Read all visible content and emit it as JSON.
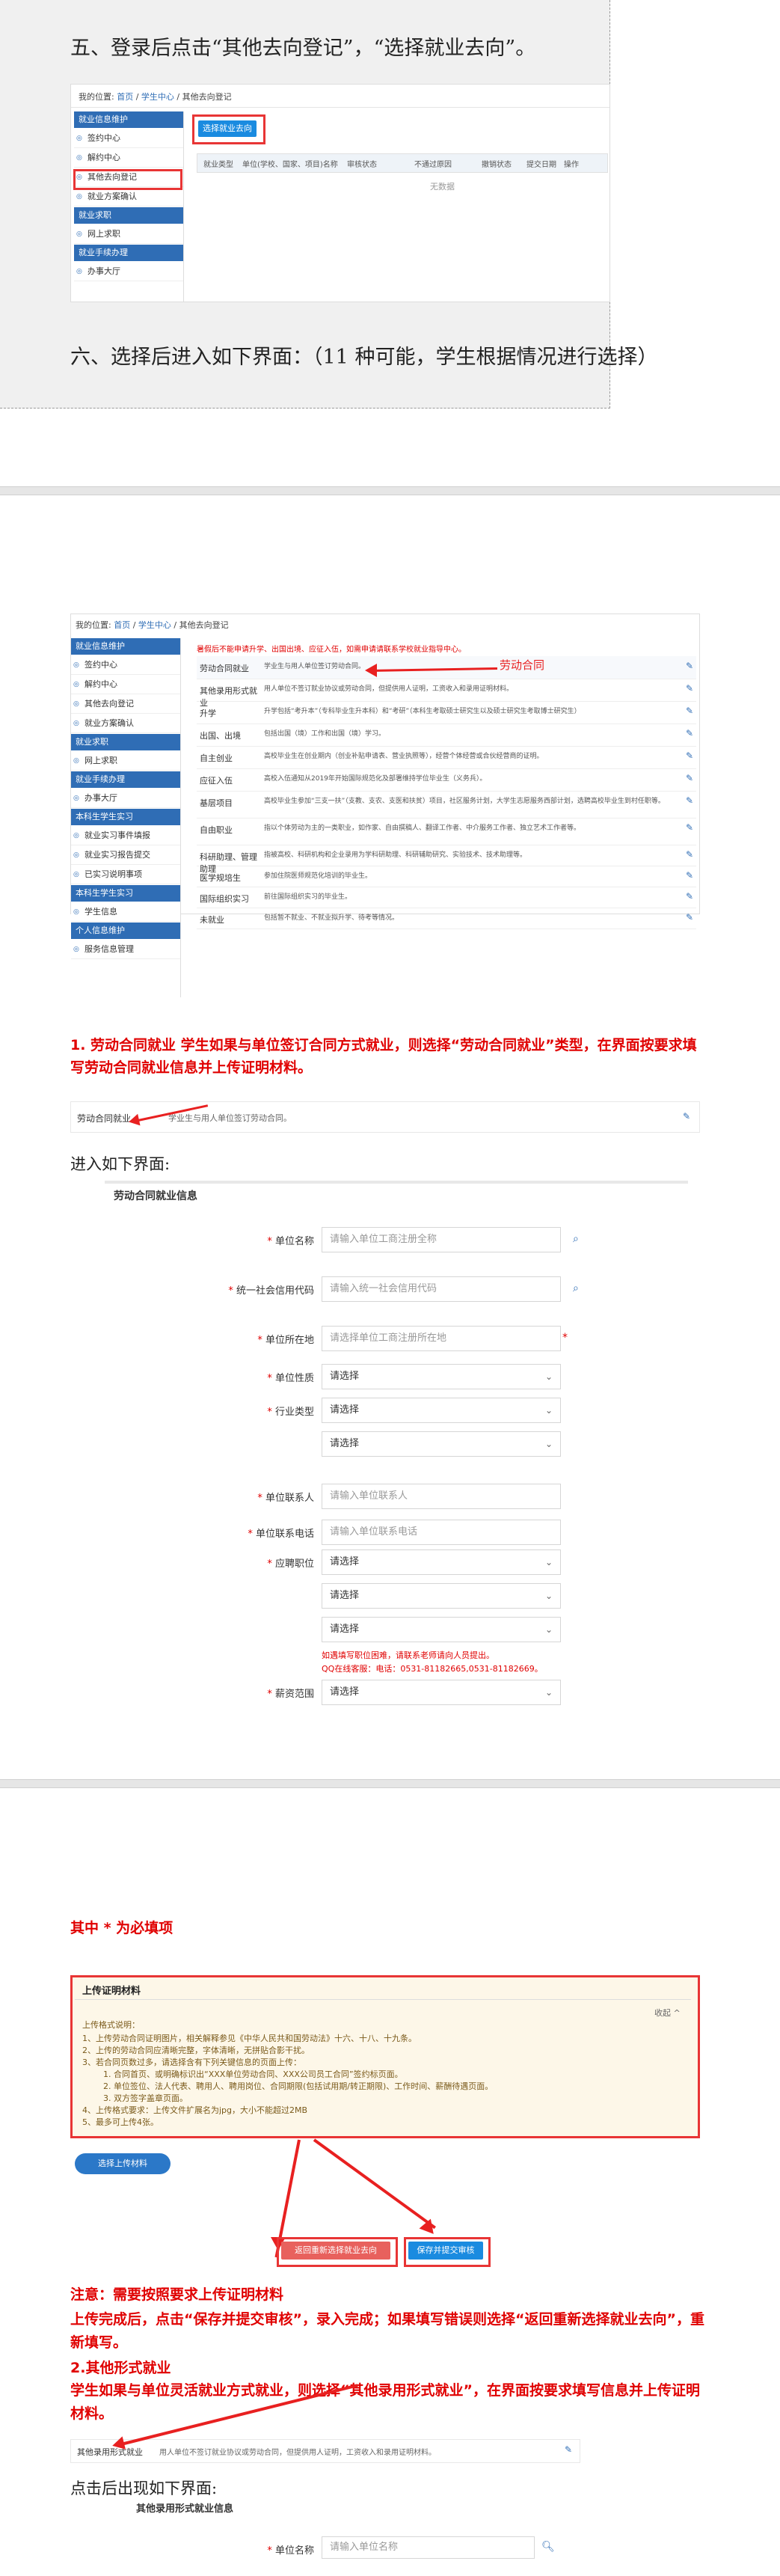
{
  "section5": {
    "heading": "五、登录后点击“其他去向登记”，“选择就业去向”。",
    "breadcrumb_prefix": "我的位置:",
    "breadcrumb_home": "首页",
    "breadcrumb_center": "学生中心",
    "breadcrumb_current": "其他去向登记",
    "sidebar": [
      {
        "type": "head",
        "label": "就业信息维护"
      },
      {
        "type": "item",
        "label": "签约中心"
      },
      {
        "type": "item",
        "label": "解约中心"
      },
      {
        "type": "item",
        "label": "其他去向登记"
      },
      {
        "type": "item",
        "label": "就业方案确认"
      },
      {
        "type": "head",
        "label": "就业求职"
      },
      {
        "type": "item",
        "label": "网上求职"
      },
      {
        "type": "head",
        "label": "就业手续办理"
      },
      {
        "type": "item",
        "label": "办事大厅"
      }
    ],
    "choose_button": "选择就业去向",
    "table_headers": [
      "就业类型",
      "单位(学校、国家、项目)名称",
      "审核状态",
      "不通过原因",
      "撤销状态",
      "提交日期",
      "操作"
    ],
    "empty_text": "无数据"
  },
  "section6": {
    "heading": "六、选择后进入如下界面：（11 种可能，学生根据情况进行选择）"
  },
  "options_page": {
    "breadcrumb_prefix": "我的位置:",
    "breadcrumb_home": "首页",
    "breadcrumb_center": "学生中心",
    "breadcrumb_current": "其他去向登记",
    "notice": "暑假后不能申请升学、出国出境、应征入伍，如需申请请联系学校就业指导中心。",
    "annotation_label": "劳动合同",
    "sidebar": [
      {
        "type": "head",
        "label": "就业信息维护"
      },
      {
        "type": "item",
        "label": "签约中心"
      },
      {
        "type": "item",
        "label": "解约中心"
      },
      {
        "type": "item",
        "label": "其他去向登记"
      },
      {
        "type": "item",
        "label": "就业方案确认"
      },
      {
        "type": "head",
        "label": "就业求职"
      },
      {
        "type": "item",
        "label": "网上求职"
      },
      {
        "type": "head",
        "label": "就业手续办理"
      },
      {
        "type": "item",
        "label": "办事大厅"
      },
      {
        "type": "head",
        "label": "本科生学生实习"
      },
      {
        "type": "item",
        "label": "就业实习事件填报"
      },
      {
        "type": "item",
        "label": "就业实习报告提交"
      },
      {
        "type": "item",
        "label": "已实习说明事项"
      },
      {
        "type": "head",
        "label": "本科生学生实习"
      },
      {
        "type": "item",
        "label": "学生信息"
      },
      {
        "type": "head",
        "label": "个人信息维护"
      },
      {
        "type": "item",
        "label": "服务信息管理"
      }
    ],
    "options": [
      {
        "name": "劳动合同就业",
        "desc": "学业生与用人单位签订劳动合同。"
      },
      {
        "name": "其他录用形式就业",
        "desc": "用人单位不签订就业协议或劳动合同，但提供用人证明，工资收入和录用证明材料。"
      },
      {
        "name": "升学",
        "desc": "升学包括“考升本”（专科毕业生升本科）和“考研”（本科生考取硕士研究生以及硕士研究生考取博士研究生）"
      },
      {
        "name": "出国、出境",
        "desc": "包括出国（境）工作和出国（境）学习。"
      },
      {
        "name": "自主创业",
        "desc": "高校毕业生在创业期内（创业补贴申请表、营业执照等），经营个体经营或合伙经营商的证明。"
      },
      {
        "name": "应征入伍",
        "desc": "高校入伍通知从2019年开始国际规范化及部署维持学位毕业生（义务兵）。"
      },
      {
        "name": "基层项目",
        "desc": "高校毕业生参加“三支一扶”（支教、支农、支医和扶贫）项目，社区服务计划，大学生志愿服务西部计划，选聘高校毕业生到村任职等。"
      },
      {
        "name": "自由职业",
        "desc": "指以个体劳动为主的一类职业，如作家、自由撰稿人、翻译工作者、中介服务工作者、独立艺术工作者等。"
      },
      {
        "name": "科研助理、管理助理",
        "desc": "指被高校、科研机构和企业录用为学科研助理、科研辅助研究、实验技术、技术助理等。"
      },
      {
        "name": "医学规培生",
        "desc": "参加住院医师规范化培训的毕业生。"
      },
      {
        "name": "国际组织实习",
        "desc": "前往国际组织实习的毕业生。"
      },
      {
        "name": "未就业",
        "desc": "包括暂不就业、不就业拟升学、待考等情况。"
      }
    ]
  },
  "item1": {
    "text": "1. 劳动合同就业 学生如果与单位签订合同方式就业，则选择“劳动合同就业”类型，在界面按要求填写劳动合同就业信息并上传证明材料。",
    "option_name": "劳动合同就业",
    "option_desc": "学业生与用人单位签订劳动合同。"
  },
  "enter_text": "进入如下界面:",
  "form1": {
    "title": "劳动合同就业信息",
    "fields": [
      {
        "label": "单位名称",
        "kind": "input",
        "placeholder": "请输入单位工商注册全称",
        "search": true
      },
      {
        "label": "统一社会信用代码",
        "kind": "input",
        "placeholder": "请输入统一社会信用代码",
        "search": true
      },
      {
        "label": "单位所在地",
        "kind": "input",
        "placeholder": "请选择单位工商注册所在地",
        "search": false
      }
    ],
    "nature_label": "单位性质",
    "industry_label": "行业类型",
    "contact_label": "单位联系人",
    "contact_placeholder": "请输入单位联系人",
    "phone_label": "单位联系电话",
    "phone_placeholder": "请输入单位联系电话",
    "position_label": "应聘职位",
    "salary_label": "薪资范围",
    "select_placeholder": "请选择",
    "hint_line1": "如遇填写职位困难，请联系老师请向人员提出。",
    "hint_line2": "QQ在线客服：电话：0531-81182665,0531-81182669。"
  },
  "required_note": "其中 * 为必填项",
  "upload": {
    "title": "上传证明材料",
    "collapse": "收起 ^",
    "intro": "上传格式说明：",
    "lines": [
      "1、上传劳动合同证明图片，相关解释参见《中华人民共和国劳动法》十六、十八、十九条。",
      "2、上传的劳动合同应清晰完整，字体清晰，无拼贴合影干扰。",
      "3、若合同页数过多，请选择含有下列关键信息的页面上传：",
      "1. 合同首页、或明确标识出“XXX单位劳动合同、XXX公司员工合同”签约标页面。",
      "2. 单位签位、法人代表、聘用人、聘用岗位、合同期限(包括试用期/转正期限)、工作时间、薪酬待遇页面。",
      "3. 双方签字盖章页面。",
      "4、上传格式要求：上传文件扩展名为jpg，大小不能超过2MB",
      "5、最多可上传4张。"
    ],
    "select_file": "选择上传材料",
    "return_button": "返回重新选择就业去向",
    "save_button": "保存并提交审核"
  },
  "notes": {
    "attention": "注意：需要按照要求上传证明材料",
    "after_upload": "上传完成后，点击“保存并提交审核”，录入完成；如果填写错误则选择“返回重新选择就业去向”，重新填写。",
    "item2_title": "2.其他形式就业",
    "item2_text": "学生如果与单位灵活就业方式就业，则选择“其他录用形式就业”，在界面按要求填写信息并上传证明材料。",
    "option2_name": "其他录用形式就业",
    "option2_desc": "用人单位不签订就业协议或劳动合同，但提供用人证明，工资收入和录用证明材料。",
    "after_click": "点击后出现如下界面:",
    "form2_title": "其他录用形式就业信息",
    "form2_label": "单位名称",
    "form2_placeholder": "请输入单位名称"
  }
}
